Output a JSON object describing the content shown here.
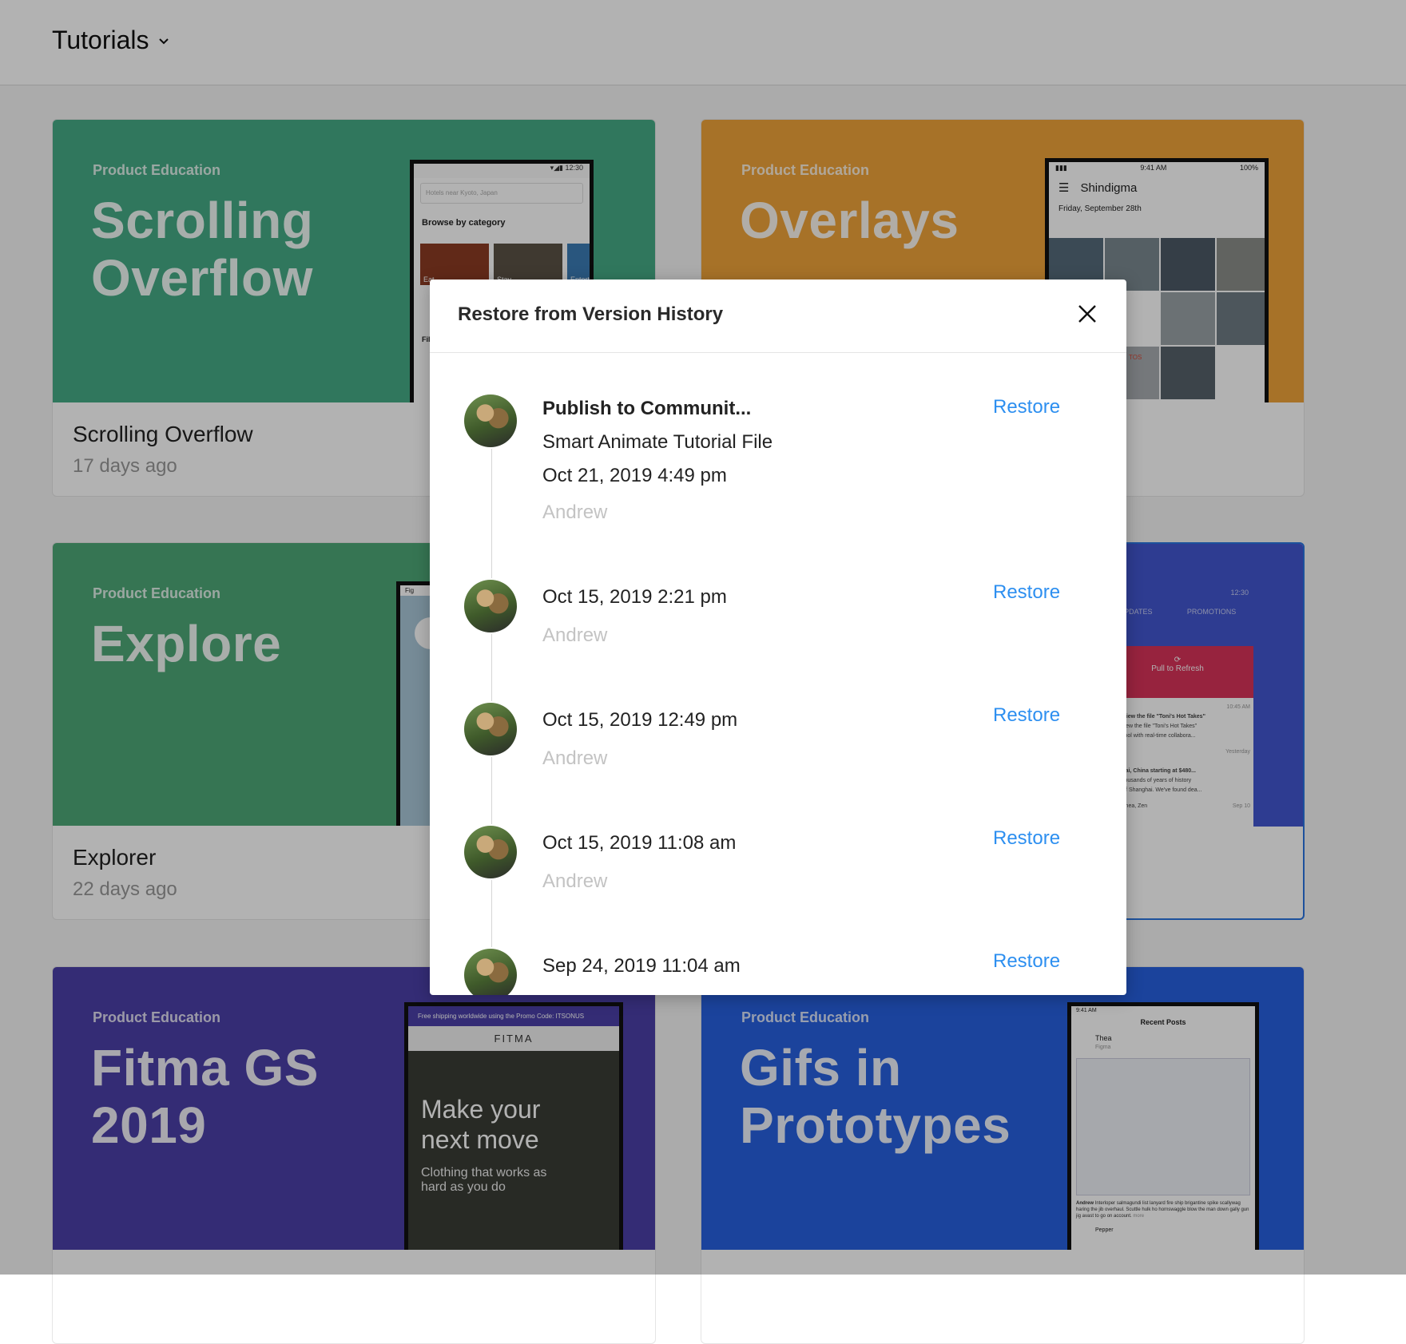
{
  "header": {
    "title": "Tutorials"
  },
  "cards": [
    {
      "category": "Product Education",
      "big_title": "Scrolling Overflow",
      "name": "Scrolling Overflow",
      "when": "17 days ago",
      "color": "#46ab86",
      "phone": {
        "search": "Hotels near Kyoto, Japan",
        "section": "Browse by category",
        "tiles": [
          "Eat",
          "Stay",
          "Entertain",
          "Pl"
        ],
        "foot": "Fil"
      }
    },
    {
      "category": "Product Education",
      "big_title": "Overlays",
      "name": "",
      "when": "",
      "color": "#f0a43a",
      "phone": {
        "time": "9:41 AM",
        "battery": "100%",
        "app": "Shindigma",
        "date": "Friday, September 28th",
        "tag": "TOS"
      }
    },
    {
      "category": "Product Education",
      "big_title": "Explore",
      "name": "Explorer",
      "when": "22 days ago",
      "color": "#4ea878",
      "phone": {
        "status": "Fig"
      }
    },
    {
      "category": "",
      "big_title": "",
      "name": "",
      "when": "",
      "color": "#4356d0",
      "phone": {
        "time": "12:30",
        "tab1": "UPDATES",
        "tab2": "PROMOTIONS",
        "refresh": "Pull to Refresh",
        "t1": "10:45 AM",
        "l1": "you to view the file \"Toni's Hot Takes\"",
        "l2": "you to view the file \"Toni's Hot Takes\"",
        "l3": "design tool with real-time collabora...",
        "t2": "Yesterday",
        "l4": "s",
        "l5": "Shanghai, China starting at $480...",
        "l6": "ience thousands of years of history",
        "l7": "ral city of Shanghai. We've found dea...",
        "l8": "epper, Thea, Zen",
        "t3": "Sep 10"
      }
    },
    {
      "category": "Product Education",
      "big_title": "Fitma GS 2019",
      "name": "",
      "when": "",
      "color": "#4b40a8",
      "phone": {
        "promo": "Free shipping worldwide using the Promo Code: ITSONUS",
        "brand": "FITMA",
        "headline": "Make your next move",
        "tagline": "Clothing that works as hard as you do"
      }
    },
    {
      "category": "Product Education",
      "big_title": "Gifs in Prototypes",
      "name": "",
      "when": "",
      "color": "#2760e0",
      "phone": {
        "time": "9:41 AM",
        "title": "Recent Posts",
        "user": "Thea",
        "user_sub": "Figma",
        "comment_user": "Andrew",
        "comment": "Interloper salmagundi list lanyard fire ship brigantine spike scallywag haring the jib overhaul. Scuttle hulk ho hornswaggle blow the man down gally gun jig avast to go on account.",
        "more": "more",
        "user2": "Pepper"
      }
    }
  ],
  "modal": {
    "title": "Restore from Version History",
    "restore_label": "Restore",
    "entries": [
      {
        "title": "Publish to Communit...",
        "subtitle": "Smart Animate Tutorial File",
        "date": "Oct 21, 2019 4:49 pm",
        "user": "Andrew"
      },
      {
        "date": "Oct 15, 2019 2:21 pm",
        "user": "Andrew"
      },
      {
        "date": "Oct 15, 2019 12:49 pm",
        "user": "Andrew"
      },
      {
        "date": "Oct 15, 2019 11:08 am",
        "user": "Andrew"
      },
      {
        "date": "Sep 24, 2019 11:04 am"
      }
    ]
  },
  "colors": {
    "accent": "#2d8ff0",
    "selected_border": "#2a75e0"
  }
}
